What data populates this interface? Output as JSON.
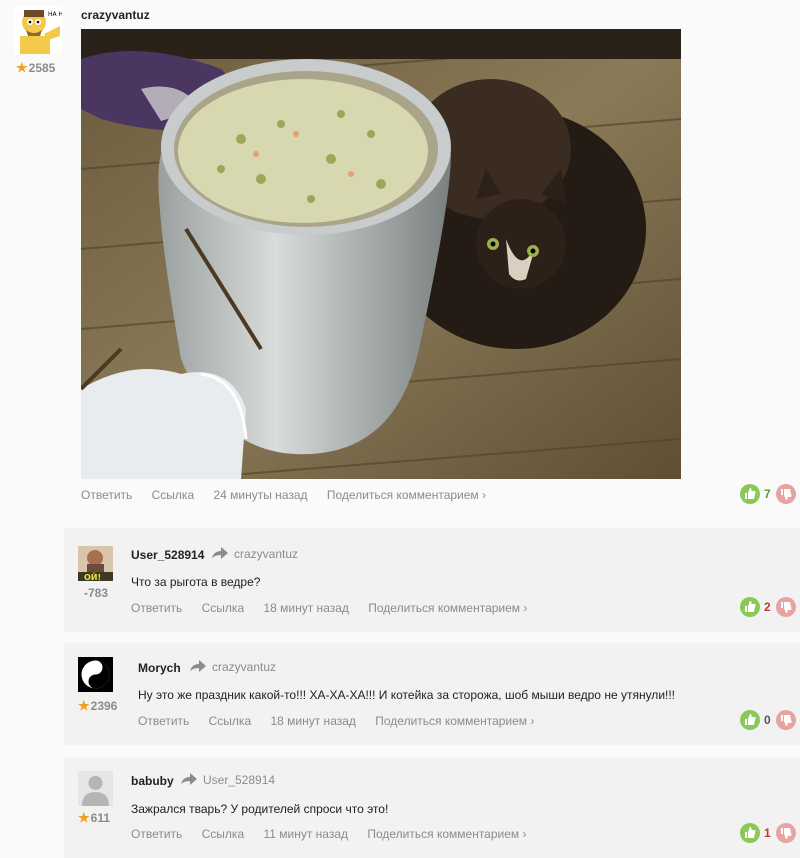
{
  "colors": {
    "rating_star": "#f0a21e",
    "vote_up": "#8ac858",
    "vote_down": "#e8a2a2",
    "score_positive": "#5a9e2f"
  },
  "comments": [
    {
      "author": "crazyvantuz",
      "rating": "2585",
      "actions": {
        "reply": "Ответить",
        "link": "Ссылка",
        "time": "24 минуты назад",
        "share": "Поделиться комментарием ›"
      },
      "score": "7"
    },
    {
      "author": "User_528914",
      "reply_to": "crazyvantuz",
      "rating": "-783",
      "text": "Что за рыгота в ведре?",
      "actions": {
        "reply": "Ответить",
        "link": "Ссылка",
        "time": "18 минут назад",
        "share": "Поделиться комментарием ›"
      },
      "score": "2"
    },
    {
      "author": "Morych",
      "reply_to": "crazyvantuz",
      "rating": "2396",
      "text": "Ну это же праздник какой-то!!! ХА-ХА-ХА!!! И котейка за сторожа, шоб мыши ведро не утянули!!!",
      "actions": {
        "reply": "Ответить",
        "link": "Ссылка",
        "time": "18 минут назад",
        "share": "Поделиться комментарием ›"
      },
      "score": "0"
    },
    {
      "author": "babuby",
      "reply_to": "User_528914",
      "rating": "611",
      "text": "Зажрался тварь? У родителей спроси что это!",
      "actions": {
        "reply": "Ответить",
        "link": "Ссылка",
        "time": "11 минут назад",
        "share": "Поделиться комментарием ›"
      },
      "score": "1"
    }
  ]
}
